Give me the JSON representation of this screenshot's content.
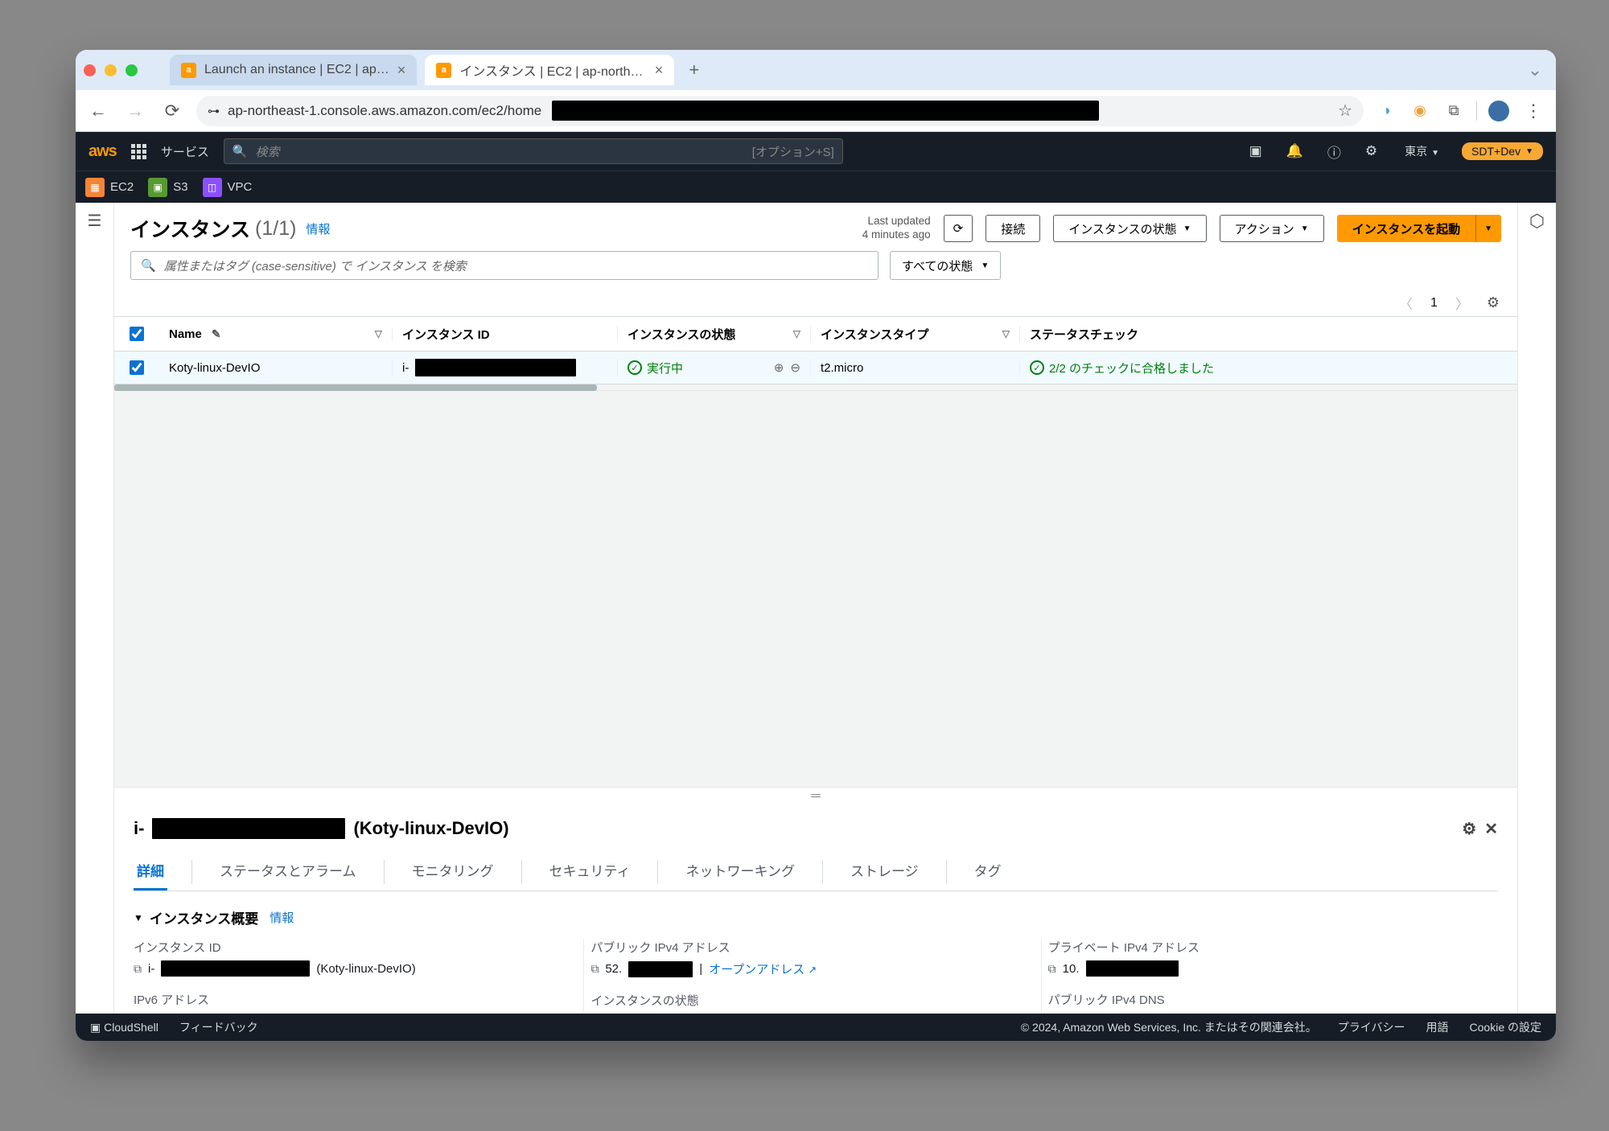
{
  "browser": {
    "tabs": [
      {
        "title": "Launch an instance | EC2 | ap…",
        "active": false
      },
      {
        "title": "インスタンス | EC2 | ap-northe…",
        "active": true
      }
    ],
    "url_prefix": "ap-northeast-1.console.aws.amazon.com/ec2/home"
  },
  "aws_nav": {
    "services": "サービス",
    "search_ph": "検索",
    "search_hint": "[オプション+S]",
    "region": "東京",
    "account": "SDT+Dev"
  },
  "svc_shortcuts": [
    "EC2",
    "S3",
    "VPC"
  ],
  "header": {
    "title": "インスタンス",
    "count": "(1/1)",
    "info": "情報",
    "last_updated_l1": "Last updated",
    "last_updated_l2": "4 minutes ago",
    "connect": "接続",
    "state": "インスタンスの状態",
    "actions": "アクション",
    "launch": "インスタンスを起動"
  },
  "filter": {
    "placeholder": "属性またはタグ (case-sensitive) で インスタンス を検索",
    "states": "すべての状態"
  },
  "pager": {
    "page": "1"
  },
  "columns": {
    "name": "Name",
    "id": "インスタンス ID",
    "state": "インスタンスの状態",
    "type": "インスタンスタイプ",
    "status": "ステータスチェック"
  },
  "row": {
    "name": "Koty-linux-DevIO",
    "id_prefix": "i-",
    "state": "実行中",
    "type": "t2.micro",
    "status": "2/2 のチェックに合格しました"
  },
  "detail": {
    "title_prefix": "i-",
    "title_suffix": "(Koty-linux-DevIO)",
    "tabs": [
      "詳細",
      "ステータスとアラーム",
      "モニタリング",
      "セキュリティ",
      "ネットワーキング",
      "ストレージ",
      "タグ"
    ],
    "section_title": "インスタンス概要",
    "section_info": "情報",
    "f1": {
      "label": "インスタンス ID",
      "val_prefix": "i-",
      "val_suffix": " (Koty-linux-DevIO)"
    },
    "f2": {
      "label": "パブリック IPv4 アドレス",
      "val_prefix": "52.",
      "open": "オープンアドレス"
    },
    "f3": {
      "label": "プライベート IPv4 アドレス",
      "val_prefix": "10."
    },
    "f4": {
      "label": "IPv6 アドレス"
    },
    "f5": {
      "label": "インスタンスの状態"
    },
    "f6": {
      "label": "パブリック IPv4 DNS"
    }
  },
  "footer": {
    "cloudshell": "CloudShell",
    "feedback": "フィードバック",
    "copy": "© 2024, Amazon Web Services, Inc. またはその関連会社。",
    "privacy": "プライバシー",
    "terms": "用語",
    "cookie": "Cookie の設定"
  }
}
